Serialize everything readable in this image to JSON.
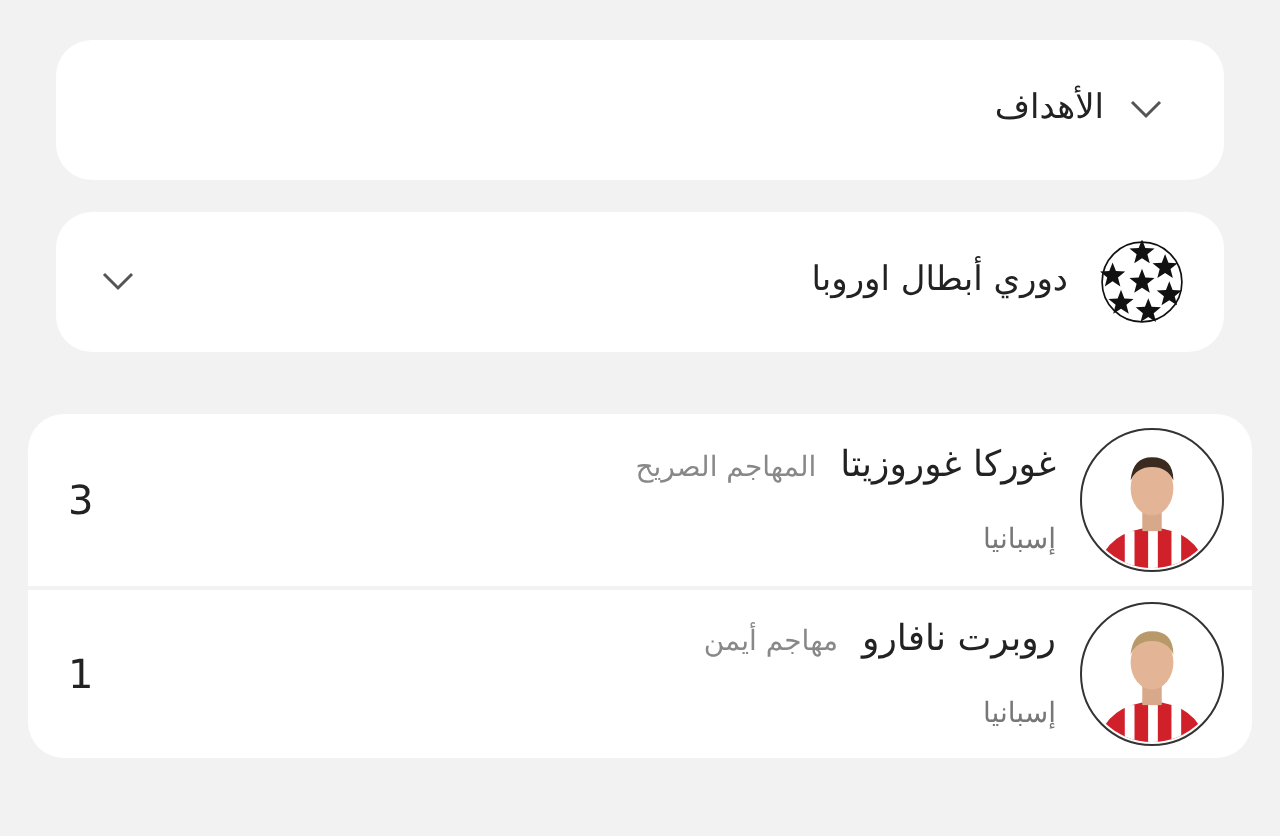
{
  "filter": {
    "label": "الأهداف"
  },
  "competition": {
    "name": "دوري أبطال اوروبا"
  },
  "players": [
    {
      "name": "غوركا غوروزيتا",
      "position": "المهاجم الصريح",
      "country": "إسبانيا",
      "goals": "3",
      "kind": "picture"
    },
    {
      "name": "روبرت نافارو",
      "position": "مهاجم أيمن",
      "country": "إسبانيا",
      "goals": "1",
      "kind": "picture"
    }
  ]
}
